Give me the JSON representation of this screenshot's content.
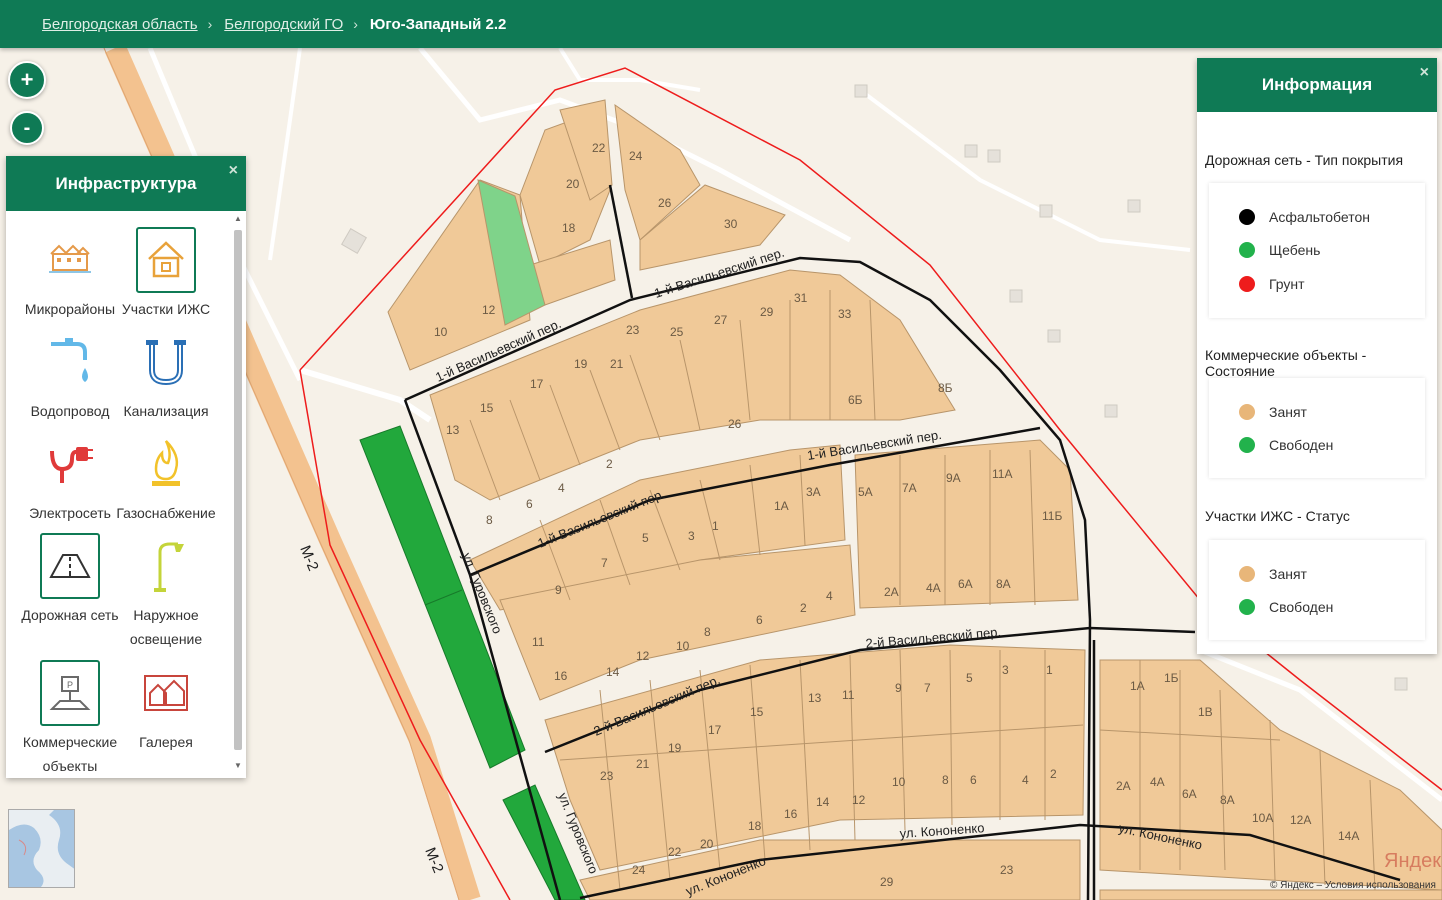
{
  "breadcrumb": {
    "items": [
      "Белгородская область",
      "Белгородский ГО"
    ],
    "current": "Юго-Западный 2.2"
  },
  "zoom": {
    "plus": "+",
    "minus": "-"
  },
  "infrastructure": {
    "title": "Инфраструктура",
    "close": "×",
    "items": [
      {
        "label": "Микрорайоны",
        "icon": "microdistricts-icon"
      },
      {
        "label": "Участки ИЖС",
        "icon": "house-plot-icon"
      },
      {
        "label": "Водопровод",
        "icon": "water-tap-icon"
      },
      {
        "label": "Канализация",
        "icon": "sewer-pipe-icon"
      },
      {
        "label": "Электросеть",
        "icon": "power-plug-icon"
      },
      {
        "label": "Газоснабжение",
        "icon": "gas-flame-icon"
      },
      {
        "label": "Дорожная сеть",
        "icon": "road-icon"
      },
      {
        "label": "Наружное освещение",
        "icon": "street-lamp-icon"
      },
      {
        "label": "Коммерческие объекты",
        "icon": "commercial-building-icon"
      },
      {
        "label": "Галерея",
        "icon": "gallery-icon"
      }
    ]
  },
  "info": {
    "title": "Информация",
    "close": "×",
    "sections": [
      {
        "title": "Дорожная сеть - Тип покрытия",
        "items": [
          {
            "label": "Асфальтобетон",
            "color": "#000000"
          },
          {
            "label": "Щебень",
            "color": "#22b24c"
          },
          {
            "label": "Грунт",
            "color": "#ee1c1c"
          }
        ]
      },
      {
        "title": "Коммерческие объекты - Состояние",
        "items": [
          {
            "label": "Занят",
            "color": "#e8b679"
          },
          {
            "label": "Свободен",
            "color": "#22b24c"
          }
        ]
      },
      {
        "title": "Участки ИЖС - Статус",
        "items": [
          {
            "label": "Занят",
            "color": "#e8b679"
          },
          {
            "label": "Свободен",
            "color": "#22b24c"
          }
        ]
      }
    ]
  },
  "map": {
    "street_labels": [
      "1-й Васильевский пер.",
      "1-й Васильевский пер.",
      "1-й Васильевский пер.",
      "1-й Васильевский пер.",
      "2-й Васильевский пер.",
      "2-й Васильевский пер.",
      "ул. Кононенко",
      "ул. Кононенко",
      "ул. Кононенко",
      "ул. Гуровского",
      "ул. Гуровского",
      "М-2",
      "М-2"
    ],
    "plot_numbers": [
      "22",
      "24",
      "20",
      "26",
      "18",
      "30",
      "10",
      "12",
      "23",
      "25",
      "27",
      "29",
      "31",
      "33",
      "17",
      "19",
      "21",
      "15",
      "13",
      "26",
      "6Б",
      "8Б",
      "2",
      "4",
      "6",
      "8",
      "3А",
      "1А",
      "1",
      "3",
      "5",
      "7",
      "9",
      "11",
      "5А",
      "7А",
      "9А",
      "11А",
      "11Б",
      "2А",
      "4А",
      "6А",
      "8А",
      "2",
      "4",
      "6",
      "8",
      "10",
      "12",
      "14",
      "16",
      "3",
      "5",
      "7",
      "9",
      "11",
      "13",
      "15",
      "17",
      "19",
      "21",
      "23",
      "1",
      "2",
      "4",
      "6",
      "8",
      "10",
      "12",
      "14",
      "16",
      "18",
      "20",
      "22",
      "24",
      "1А",
      "1Б",
      "1В",
      "2А",
      "4А",
      "6А",
      "8А",
      "10А",
      "12А",
      "14А",
      "23",
      "29"
    ],
    "yandex": "Яндекс",
    "copyright": "© Яндекс – Условия использования"
  }
}
